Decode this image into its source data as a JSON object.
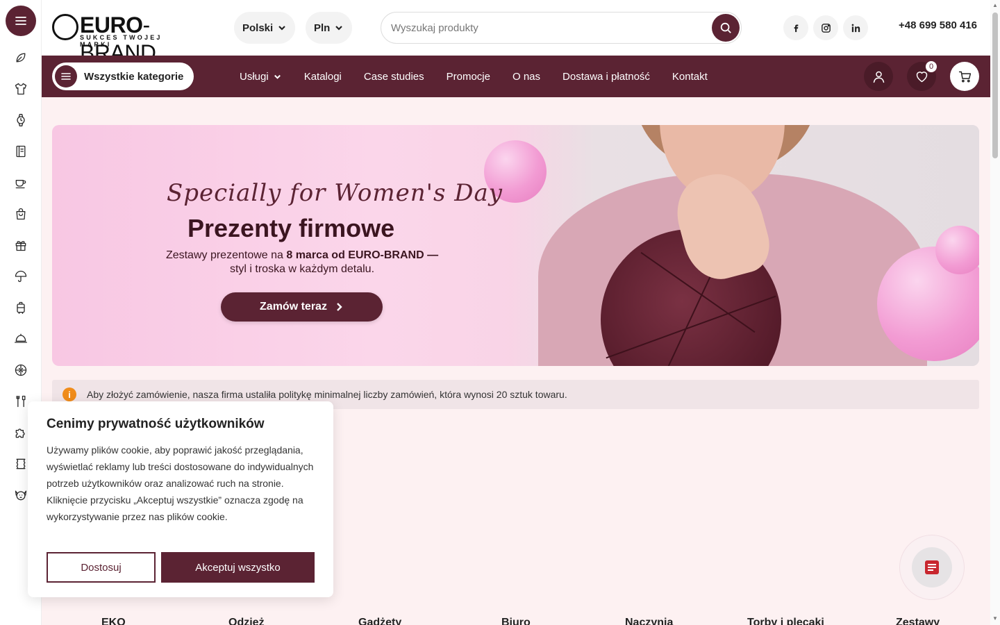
{
  "brand": {
    "logo_main_bold": "EURO",
    "logo_main_light": "-BRAND",
    "logo_tagline": "SUKCES TWOJEJ MARKI"
  },
  "header": {
    "language": "Polski",
    "currency": "Pln",
    "search_placeholder": "Wyszukaj produkty",
    "phone": "+48 699 580 416",
    "social": [
      "facebook-icon",
      "instagram-icon",
      "linkedin-icon"
    ]
  },
  "nav": {
    "all_categories": "Wszystkie kategorie",
    "links": [
      "Usługi",
      "Katalogi",
      "Case studies",
      "Promocje",
      "O nas",
      "Dostawa i płatność",
      "Kontakt"
    ],
    "wishlist_count": "0"
  },
  "sidebar": {
    "icons": [
      "leaf-icon",
      "shirt-icon",
      "watch-icon",
      "notebook-icon",
      "mug-icon",
      "shopping-bag-icon",
      "gift-icon",
      "umbrella-icon",
      "suitcase-icon",
      "cap-icon",
      "ball-icon",
      "tools-icon",
      "puzzle-icon",
      "towel-icon",
      "dog-icon"
    ]
  },
  "hero": {
    "kicker": "Specially for Women's Day",
    "title": "Prezenty firmowe",
    "subtitle_line1_a": "Zestawy prezentowe na ",
    "subtitle_line1_b": "8 marca od EURO-BRAND —",
    "subtitle_line2": "styl i troska w każdym detalu.",
    "cta": "Zamów teraz"
  },
  "notice": {
    "icon": "i",
    "text": "Aby złożyć zamówienie, nasza firma ustaliła politykę minimalnej liczby zamówień, która wynosi 20 sztuk towaru."
  },
  "categories_row": [
    "EKO",
    "Odzież",
    "Gadżety",
    "Biuro",
    "Naczynia",
    "Torby i plecaki",
    "Zestawy"
  ],
  "cookie": {
    "title": "Cenimy prywatność użytkowników",
    "text": "Używamy plików cookie, aby poprawić jakość przeglądania, wyświetlać reklamy lub treści dostosowane do indywidualnych potrzeb użytkowników oraz analizować ruch na stronie. Kliknięcie przycisku „Akceptuj wszystkie” oznacza zgodę na wykorzystywanie przez nas plików cookie.",
    "customize": "Dostosuj",
    "accept": "Akceptuj wszystko"
  },
  "colors": {
    "brand": "#5b2333",
    "page_bg": "#fdf1f2",
    "notice_icon": "#f08c1a"
  }
}
